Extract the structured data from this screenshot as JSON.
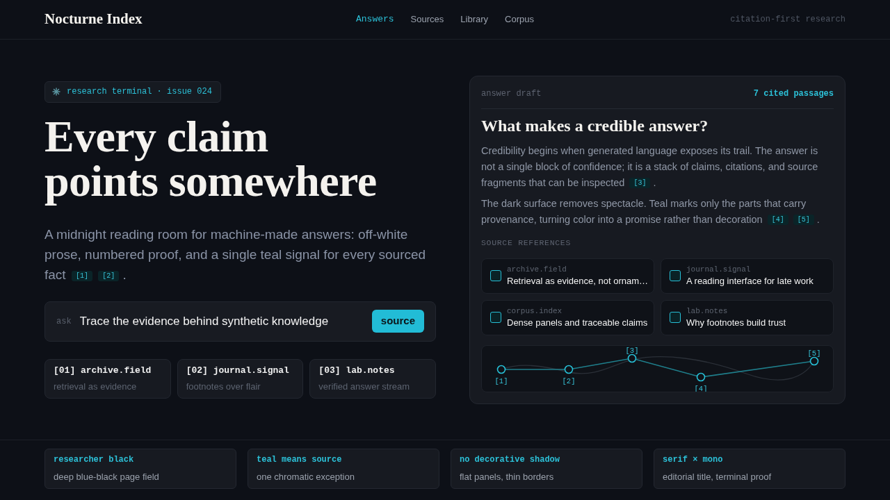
{
  "header": {
    "logo": "Nocturne Index",
    "nav": [
      {
        "label": "Answers",
        "selected": true
      },
      {
        "label": "Sources",
        "selected": false
      },
      {
        "label": "Library",
        "selected": false
      },
      {
        "label": "Corpus",
        "selected": false
      }
    ],
    "tagline": "citation-first research"
  },
  "hero": {
    "badge": "research terminal · issue 024",
    "title": "Every claim points somewhere",
    "lede": {
      "text": "A midnight reading room for machine-made answers: off-white prose, numbered proof, and a single teal signal for every sourced fact",
      "citations": [
        "[1]",
        "[2]"
      ],
      "after": "."
    },
    "ask": {
      "label": "ask",
      "value": "Trace the evidence behind synthetic knowledge",
      "button": "source"
    },
    "sources": [
      {
        "name": "[01] archive.field",
        "note": "retrieval as evidence"
      },
      {
        "name": "[02] journal.signal",
        "note": "footnotes over flair"
      },
      {
        "name": "[03] lab.notes",
        "note": "verified answer stream"
      }
    ]
  },
  "answer_panel": {
    "label": "answer draft",
    "count": "7 cited passages",
    "title": "What makes a credible answer?",
    "paragraphs": [
      {
        "text": "Credibility begins when generated language exposes its trail. The answer is not a single block of confidence; it is a stack of claims, citations, and source fragments that can be inspected",
        "citations": [
          "[3]"
        ],
        "after": "."
      },
      {
        "text": "The dark surface removes spectacle. Teal marks only the parts that carry provenance, turning color into a promise rather than decoration",
        "citations": [
          "[4]",
          "[5]"
        ],
        "after": "."
      }
    ],
    "references_label": "SOURCE REFERENCES",
    "references": [
      {
        "source": "archive.field",
        "title": "Retrieval as evidence, not ornam…",
        "checked": false
      },
      {
        "source": "journal.signal",
        "title": "A reading interface for late work",
        "checked": false
      },
      {
        "source": "corpus.index",
        "title": "Dense panels and traceable claims",
        "checked": false
      },
      {
        "source": "lab.notes",
        "title": "Why footnotes build trust",
        "checked": false
      }
    ],
    "citation_trail": {
      "labels": [
        "[1]",
        "[2]",
        "[3]",
        "[4]",
        "[5]"
      ]
    }
  },
  "principles": [
    {
      "title": "researcher black",
      "text": "deep blue-black page field"
    },
    {
      "title": "teal means source",
      "text": "one chromatic exception"
    },
    {
      "title": "no decorative shadow",
      "text": "flat panels, thin borders"
    },
    {
      "title": "serif × mono",
      "text": "editorial title, terminal proof"
    }
  ]
}
